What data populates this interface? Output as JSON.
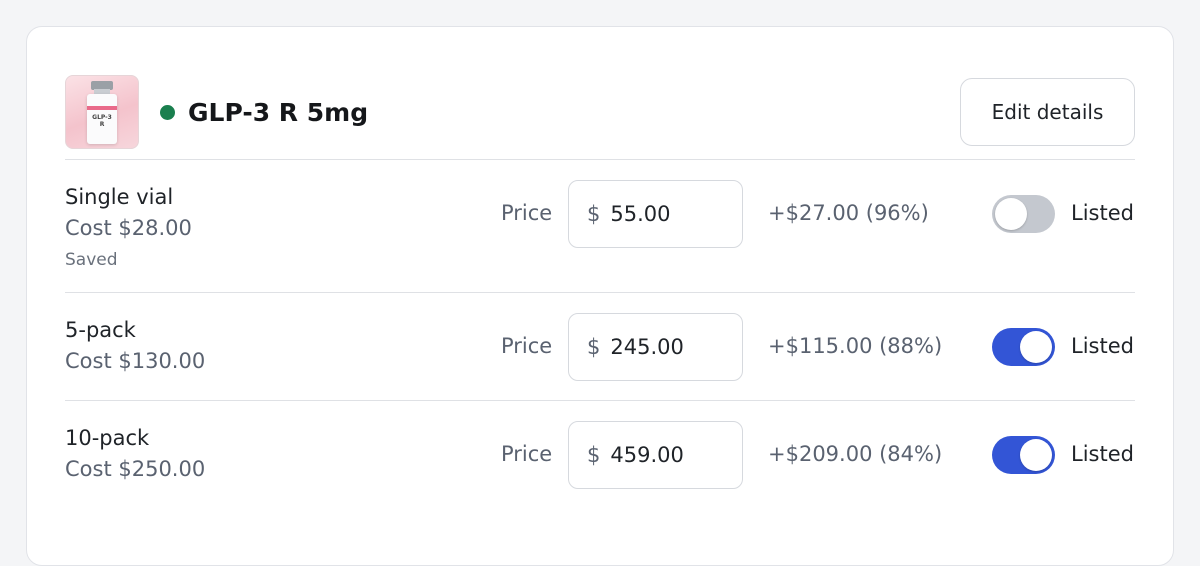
{
  "product": {
    "title": "GLP-3 R 5mg",
    "status": "active",
    "status_color": "#1a7f4e",
    "thumbnail_label": "GLP-3 R",
    "edit_label": "Edit details"
  },
  "variants": [
    {
      "name": "Single vial",
      "cost": "Cost $28.00",
      "saved": "Saved",
      "price_label": "Price",
      "currency": "$",
      "price": "55.00",
      "margin": "+$27.00 (96%)",
      "listed": false,
      "listed_label": "Listed"
    },
    {
      "name": "5-pack",
      "cost": "Cost $130.00",
      "price_label": "Price",
      "currency": "$",
      "price": "245.00",
      "margin": "+$115.00 (88%)",
      "listed": true,
      "listed_label": "Listed"
    },
    {
      "name": "10-pack",
      "cost": "Cost $250.00",
      "price_label": "Price",
      "currency": "$",
      "price": "459.00",
      "margin": "+$209.00 (84%)",
      "listed": true,
      "listed_label": "Listed"
    }
  ],
  "colors": {
    "toggle_on": "#3355d6",
    "toggle_off": "#c4c8cf"
  }
}
